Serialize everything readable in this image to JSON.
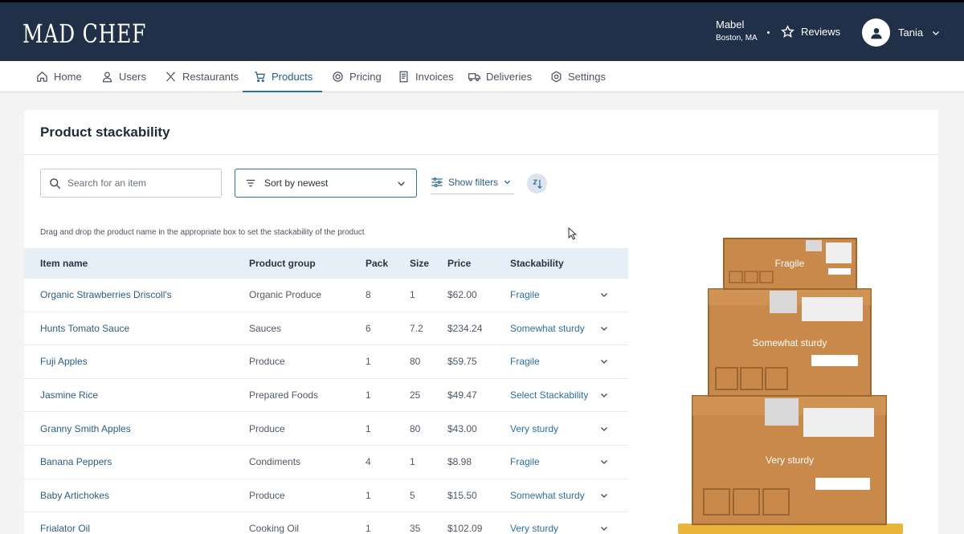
{
  "app": {
    "logo": "MAD CHEF"
  },
  "header": {
    "user_name": "Mabel",
    "user_city": "Boston, MA",
    "reviews_label": "Reviews",
    "account_name": "Tania"
  },
  "nav": {
    "items": [
      {
        "label": "Home",
        "icon": "home-icon"
      },
      {
        "label": "Users",
        "icon": "user-icon"
      },
      {
        "label": "Restaurants",
        "icon": "utensils-icon"
      },
      {
        "label": "Products",
        "icon": "cart-icon",
        "active": true
      },
      {
        "label": "Pricing",
        "icon": "pricing-icon"
      },
      {
        "label": "Invoices",
        "icon": "invoice-icon"
      },
      {
        "label": "Deliveries",
        "icon": "truck-icon"
      },
      {
        "label": "Settings",
        "icon": "gear-icon"
      }
    ]
  },
  "page": {
    "title": "Product stackability",
    "search_placeholder": "Search for an item",
    "sort_label": "Sort by newest",
    "filters_label": "Show filters",
    "hint": "Drag and drop the product name in the appropriate box to set the stackability of the product"
  },
  "table": {
    "headers": [
      "Item name",
      "Product group",
      "Pack",
      "Size",
      "Price",
      "Stackability"
    ],
    "rows": [
      {
        "name": "Organic Strawberries Driscoll's",
        "group": "Organic Produce",
        "pack": "8",
        "size": "1",
        "price": "$62.00",
        "stack": "Fragile"
      },
      {
        "name": "Hunts Tomato Sauce",
        "group": "Sauces",
        "pack": "6",
        "size": "7.2",
        "price": "$234.24",
        "stack": "Somewhat sturdy"
      },
      {
        "name": "Fuji Apples",
        "group": "Produce",
        "pack": "1",
        "size": "80",
        "price": "$59.75",
        "stack": "Fragile"
      },
      {
        "name": "Jasmine Rice",
        "group": "Prepared Foods",
        "pack": "1",
        "size": "25",
        "price": "$49.47",
        "stack": "Select Stackability"
      },
      {
        "name": "Granny Smith Apples",
        "group": "Produce",
        "pack": "1",
        "size": "80",
        "price": "$43.00",
        "stack": "Very sturdy"
      },
      {
        "name": "Banana Peppers",
        "group": "Condiments",
        "pack": "4",
        "size": "1",
        "price": "$8.98",
        "stack": "Fragile"
      },
      {
        "name": "Baby Artichokes",
        "group": "Produce",
        "pack": "1",
        "size": "5",
        "price": "$15.50",
        "stack": "Somewhat sturdy"
      },
      {
        "name": "Frialator Oil",
        "group": "Cooking Oil",
        "pack": "1",
        "size": "35",
        "price": "$102.09",
        "stack": "Very sturdy"
      }
    ]
  },
  "boxes": {
    "top_label": "Fragile",
    "middle_label": "Somewhat sturdy",
    "bottom_label": "Very sturdy"
  },
  "colors": {
    "header_bg": "#1f3048",
    "accent": "#2c6fa3",
    "table_header_bg": "#e6eef7",
    "box_brown": "#c8894a"
  }
}
